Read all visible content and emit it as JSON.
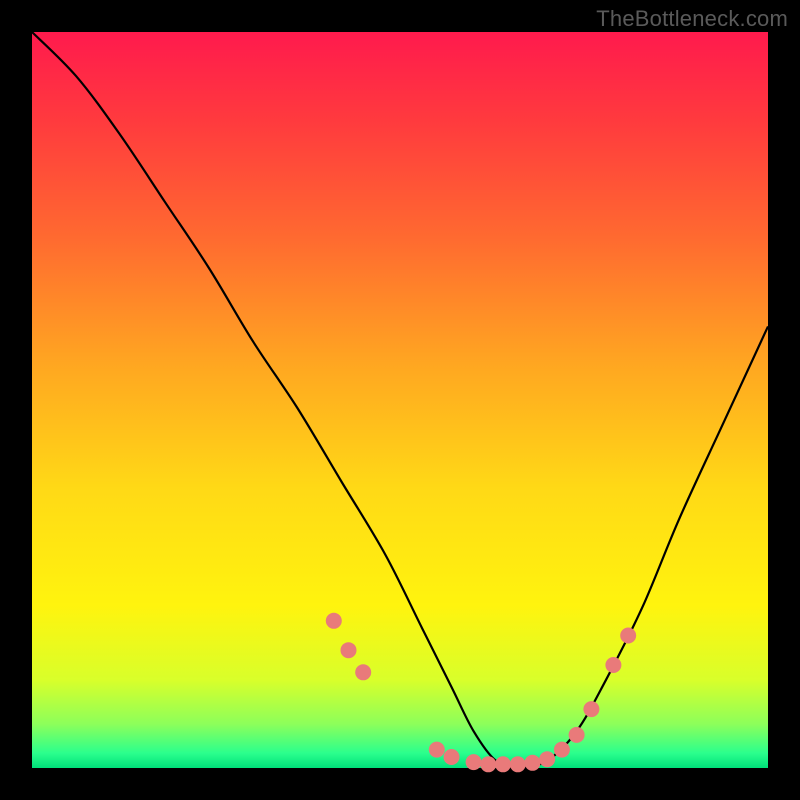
{
  "watermark": "TheBottleneck.com",
  "chart_data": {
    "type": "line",
    "title": "",
    "xlabel": "",
    "ylabel": "",
    "xlim": [
      0,
      100
    ],
    "ylim": [
      0,
      100
    ],
    "series": [
      {
        "name": "bottleneck-curve",
        "x": [
          0,
          6,
          12,
          18,
          24,
          30,
          36,
          42,
          48,
          53,
          57,
          60,
          63,
          66,
          70,
          74,
          78,
          83,
          88,
          94,
          100
        ],
        "values": [
          100,
          94,
          86,
          77,
          68,
          58,
          49,
          39,
          29,
          19,
          11,
          5,
          1,
          0,
          1,
          5,
          12,
          22,
          34,
          47,
          60
        ]
      }
    ],
    "markers": {
      "name": "highlighted-points",
      "color": "#e97a7a",
      "points": [
        {
          "x": 41,
          "y": 20
        },
        {
          "x": 43,
          "y": 16
        },
        {
          "x": 45,
          "y": 13
        },
        {
          "x": 55,
          "y": 2.5
        },
        {
          "x": 57,
          "y": 1.5
        },
        {
          "x": 60,
          "y": 0.8
        },
        {
          "x": 62,
          "y": 0.5
        },
        {
          "x": 64,
          "y": 0.5
        },
        {
          "x": 66,
          "y": 0.5
        },
        {
          "x": 68,
          "y": 0.7
        },
        {
          "x": 70,
          "y": 1.2
        },
        {
          "x": 72,
          "y": 2.5
        },
        {
          "x": 74,
          "y": 4.5
        },
        {
          "x": 76,
          "y": 8.0
        },
        {
          "x": 79,
          "y": 14
        },
        {
          "x": 81,
          "y": 18
        }
      ]
    }
  }
}
